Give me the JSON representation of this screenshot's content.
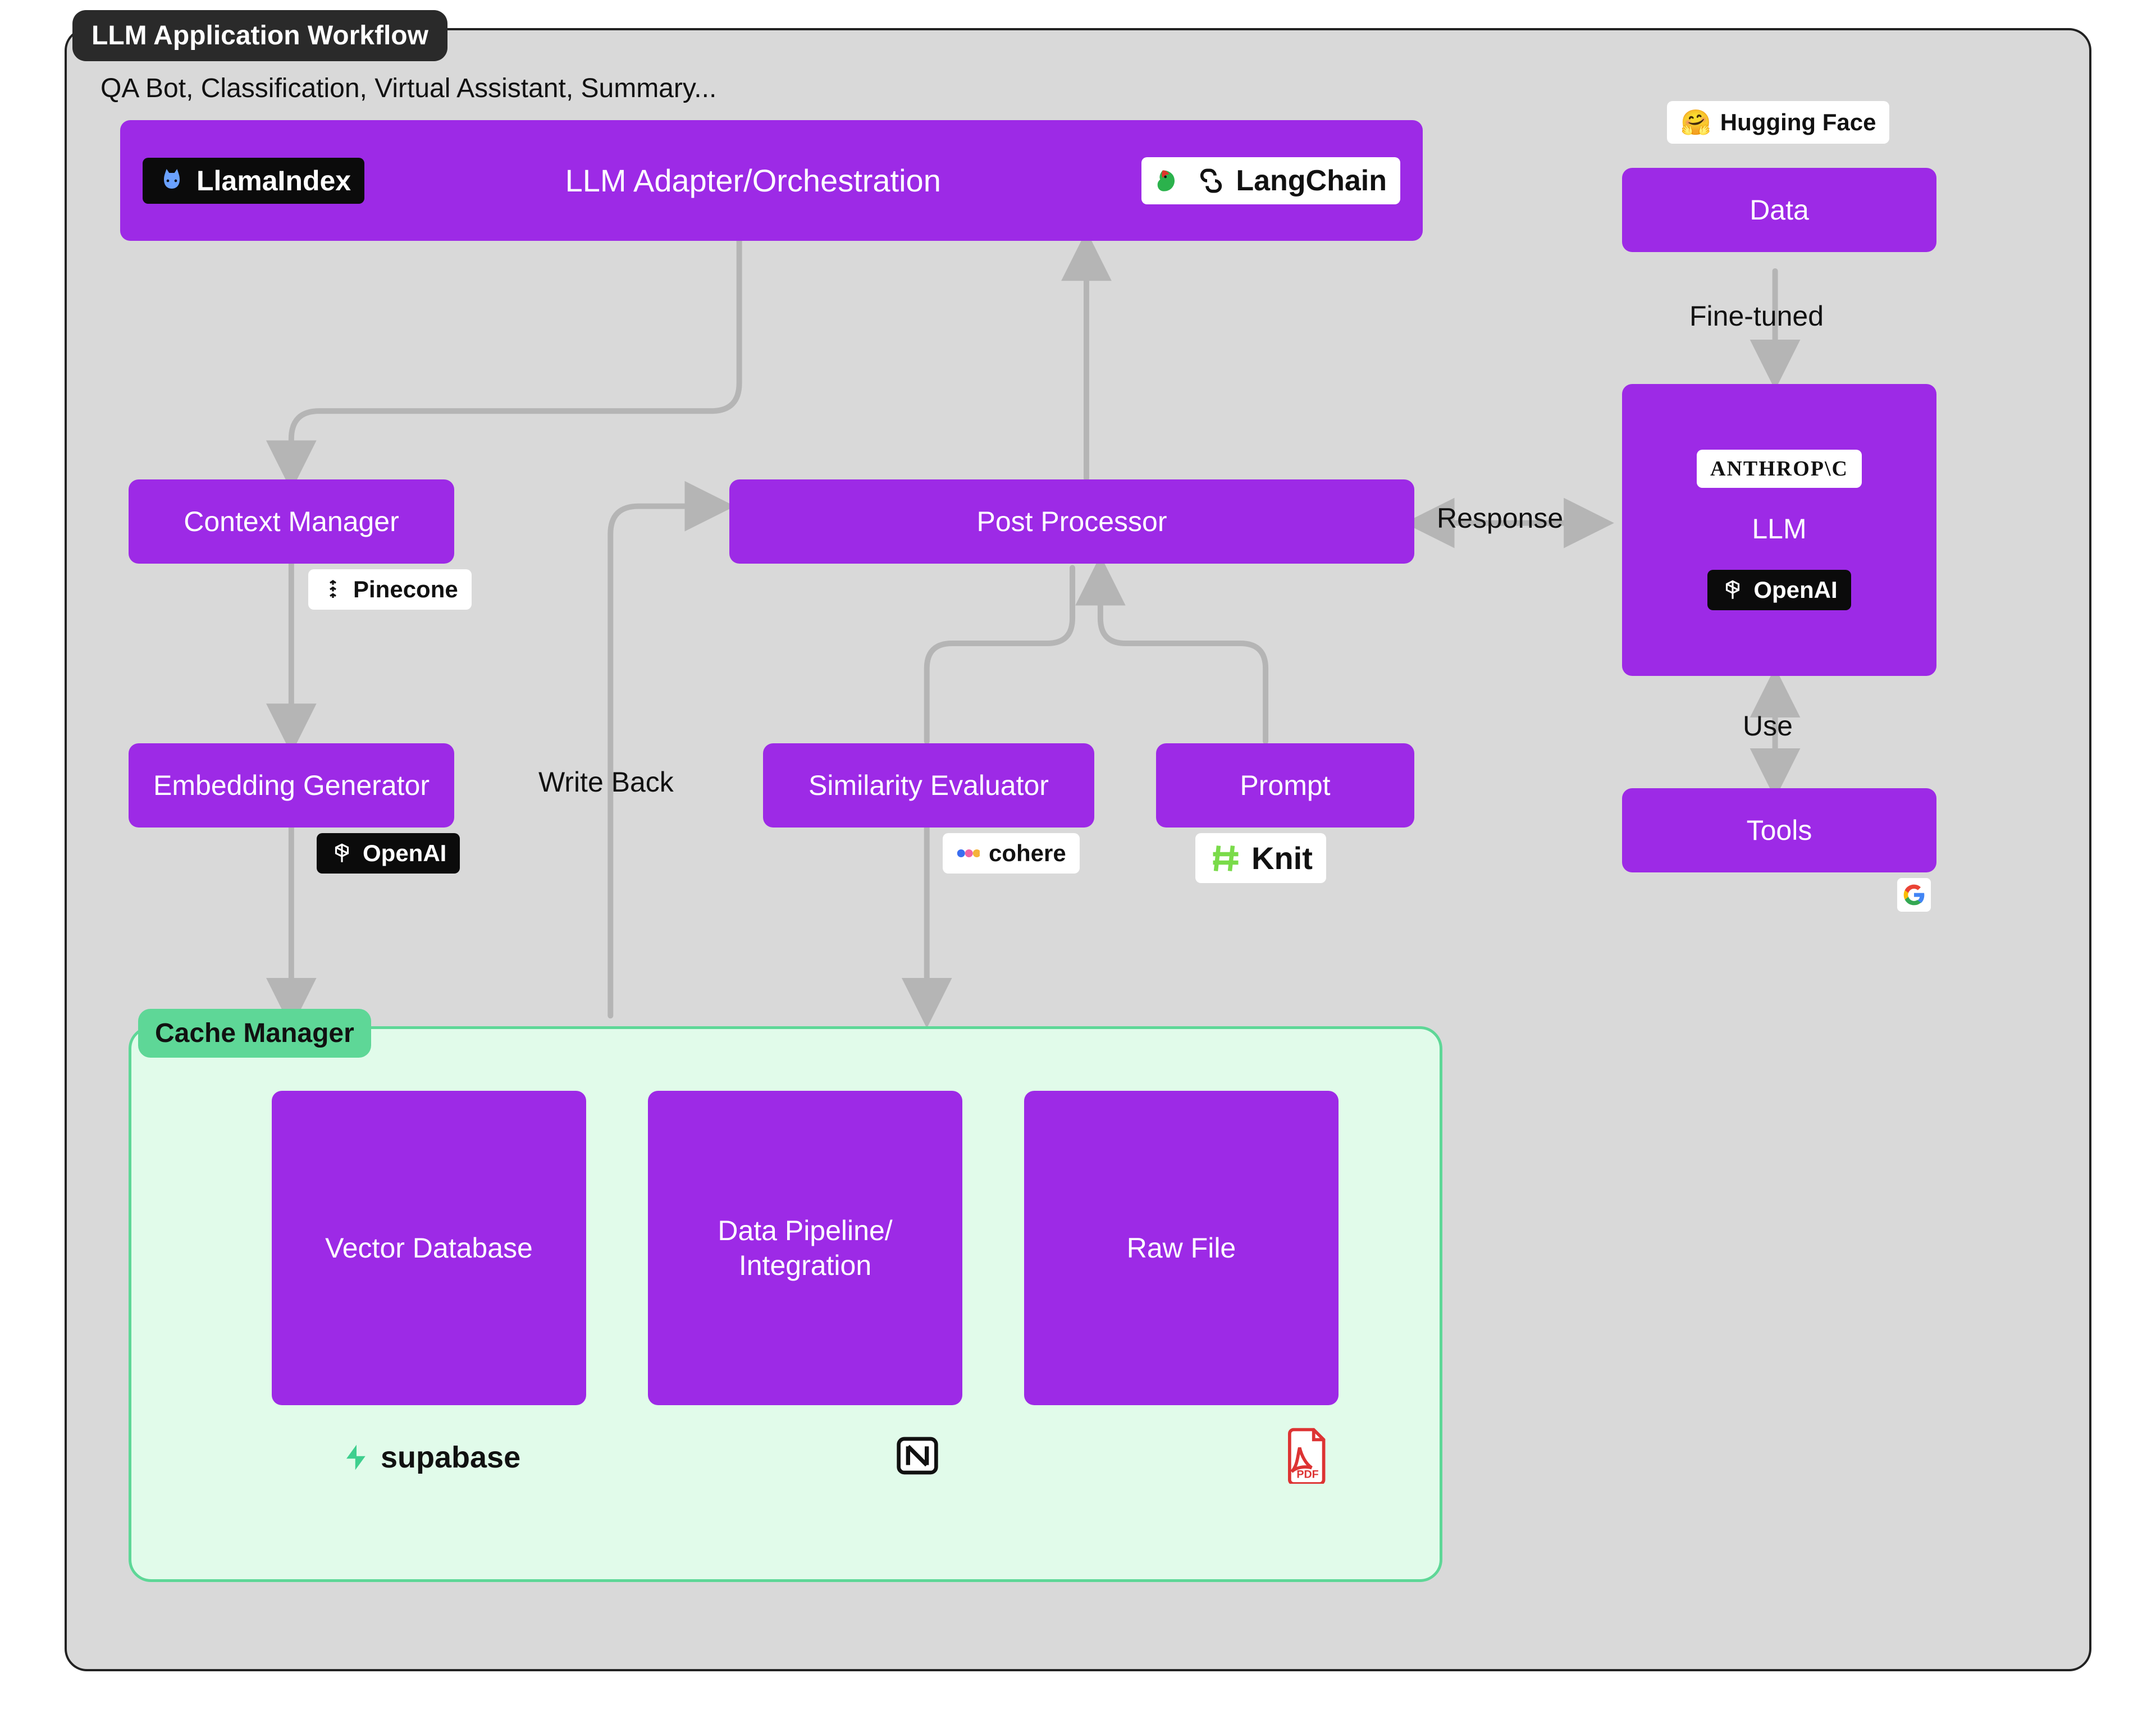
{
  "title": "LLM Application Workflow",
  "subtitle": "QA Bot, Classification, Virtual Assistant, Summary...",
  "nodes": {
    "orchestration": "LLM Adapter/Orchestration",
    "context_manager": "Context Manager",
    "embedding_generator": "Embedding Generator",
    "post_processor": "Post Processor",
    "similarity_evaluator": "Similarity Evaluator",
    "prompt": "Prompt",
    "data": "Data",
    "llm": "LLM",
    "tools": "Tools"
  },
  "edge_labels": {
    "write_back": "Write Back",
    "response": "Response",
    "fine_tuned": "Fine-tuned",
    "use": "Use"
  },
  "cache": {
    "title": "Cache Manager",
    "vector_db": "Vector Database",
    "data_pipeline": "Data Pipeline/\nIntegration",
    "raw_file": "Raw File"
  },
  "logos": {
    "llamaindex": "LlamaIndex",
    "langchain": "LangChain",
    "pinecone": "Pinecone",
    "openai": "OpenAI",
    "cohere": "cohere",
    "knit": "Knit",
    "anthropic": "ANTHROP\\C",
    "huggingface": "Hugging Face",
    "supabase": "supabase",
    "notion": "N",
    "pdf": "PDF",
    "google": "G"
  },
  "colors": {
    "accent": "#9D2AE6",
    "panel": "#D9D9D9",
    "cache_bg": "#E1FBEA",
    "cache_border": "#5ED797",
    "edge": "#b5b5b5"
  }
}
